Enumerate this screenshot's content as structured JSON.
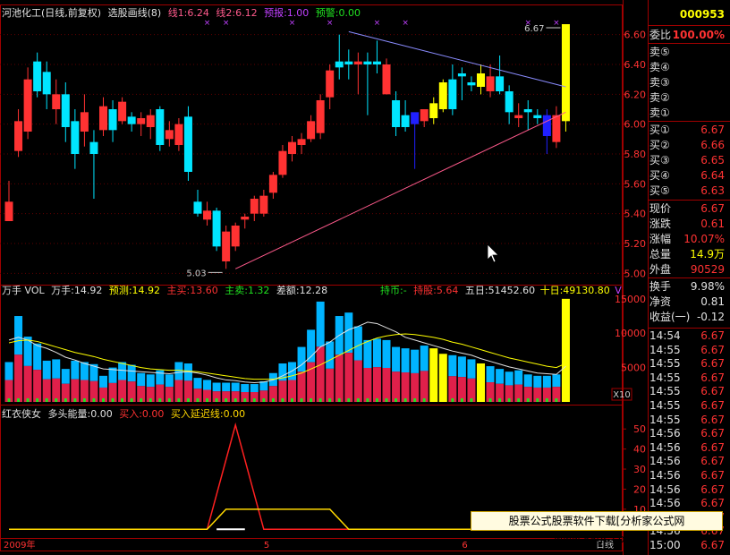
{
  "header": {
    "stock_name": "河池化工(日线,前复权)",
    "indicator_name": "选股画线(8)",
    "line1": "线1:6.24",
    "line2": "线2:6.12",
    "forecast": "预报:1.00",
    "alert": "预警:0.00"
  },
  "vol_header": {
    "title": "万手 VOL",
    "wanshou": "万手:14.92",
    "forecast": "预测:14.92",
    "buy_main": "主买:13.60",
    "sell_main": "主卖:1.32",
    "diff": "差额:12.28",
    "holding": "持币:-",
    "hold2": "持股:5.64",
    "ma5": "五日:51452.60",
    "ma10": "十日:49130.80",
    "v": "V"
  },
  "ind_header": {
    "name": "红衣侠女",
    "energy": "多头能量:0.00",
    "buy": "买入:0.00",
    "buy_delay": "买入延迟线:0.00"
  },
  "right_panel": {
    "code": "000953",
    "weibi_label": "委比",
    "weibi_value": "100.00%",
    "sell_labels": [
      "卖⑤",
      "卖④",
      "卖③",
      "卖②",
      "卖①"
    ],
    "buy_rows": [
      {
        "label": "买①",
        "value": "6.67"
      },
      {
        "label": "买②",
        "value": "6.66"
      },
      {
        "label": "买③",
        "value": "6.65"
      },
      {
        "label": "买④",
        "value": "6.64"
      },
      {
        "label": "买⑤",
        "value": "6.63"
      }
    ],
    "stats": [
      {
        "label": "现价",
        "value": "6.67",
        "color": "#ff3232"
      },
      {
        "label": "涨跌",
        "value": "0.61",
        "color": "#ff3232"
      },
      {
        "label": "涨幅",
        "value": "10.07%",
        "color": "#ff3232"
      },
      {
        "label": "总量",
        "value": "14.9万",
        "color": "#ffff00"
      },
      {
        "label": "外盘",
        "value": "90529",
        "color": "#ff3232"
      }
    ],
    "stats2": [
      {
        "label": "换手",
        "value": "9.98%",
        "color": "#e0e0e0"
      },
      {
        "label": "净资",
        "value": "0.81",
        "color": "#e0e0e0"
      },
      {
        "label": "收益(一)",
        "value": "-0.12",
        "color": "#e0e0e0"
      }
    ],
    "ticks": [
      {
        "time": "14:54",
        "price": "6.67"
      },
      {
        "time": "14:55",
        "price": "6.67"
      },
      {
        "time": "14:55",
        "price": "6.67"
      },
      {
        "time": "14:55",
        "price": "6.67"
      },
      {
        "time": "14:55",
        "price": "6.67"
      },
      {
        "time": "14:55",
        "price": "6.67"
      },
      {
        "time": "14:55",
        "price": "6.67"
      },
      {
        "time": "14:56",
        "price": "6.67"
      },
      {
        "time": "14:56",
        "price": "6.67"
      },
      {
        "time": "14:56",
        "price": "6.67"
      },
      {
        "time": "14:56",
        "price": "6.67"
      },
      {
        "time": "14:56",
        "price": "6.67"
      },
      {
        "time": "14:56",
        "price": "6.67"
      },
      {
        "time": "14:56",
        "price": "6.67"
      },
      {
        "time": "14:56",
        "price": "6.67"
      },
      {
        "time": "15:00",
        "price": "6.67"
      }
    ]
  },
  "watermark": "股票公式股票软件下载[分析家公式网www.88gs.com]",
  "bottom_labels": {
    "year": "2009年",
    "m5": "5",
    "m6": "6",
    "period": "日线"
  },
  "chart_data": [
    {
      "type": "candlestick",
      "title": "河池化工(日线,前复权)",
      "y_ticks": [
        5.0,
        5.2,
        5.4,
        5.6,
        5.8,
        6.0,
        6.2,
        6.4,
        6.6
      ],
      "ylim": [
        4.96,
        6.7
      ],
      "annotations": [
        {
          "label": "6.67"
        },
        {
          "label": "5.03"
        }
      ],
      "candles": [
        {
          "o": 5.48,
          "h": 5.62,
          "l": 5.38,
          "c": 5.35
        },
        {
          "o": 5.82,
          "h": 6.1,
          "l": 5.78,
          "c": 6.02
        },
        {
          "o": 5.95,
          "h": 6.38,
          "l": 5.9,
          "c": 6.3
        },
        {
          "o": 6.22,
          "h": 6.48,
          "l": 6.18,
          "c": 6.42
        },
        {
          "o": 6.2,
          "h": 6.42,
          "l": 6.1,
          "c": 6.35
        },
        {
          "o": 6.2,
          "h": 6.3,
          "l": 6.0,
          "c": 6.1
        },
        {
          "o": 6.2,
          "h": 6.28,
          "l": 5.88,
          "c": 5.98
        },
        {
          "o": 5.8,
          "h": 6.1,
          "l": 5.7,
          "c": 6.02
        },
        {
          "o": 6.08,
          "h": 6.2,
          "l": 5.85,
          "c": 5.95
        },
        {
          "o": 5.88,
          "h": 5.96,
          "l": 5.5,
          "c": 5.8
        },
        {
          "o": 5.96,
          "h": 6.18,
          "l": 5.92,
          "c": 6.12
        },
        {
          "o": 6.1,
          "h": 6.16,
          "l": 5.88,
          "c": 5.96
        },
        {
          "o": 6.15,
          "h": 6.18,
          "l": 6.0,
          "c": 6.02
        },
        {
          "o": 6.0,
          "h": 6.08,
          "l": 5.95,
          "c": 6.05
        },
        {
          "o": 6.04,
          "h": 6.08,
          "l": 5.92,
          "c": 6.0
        },
        {
          "o": 5.98,
          "h": 6.1,
          "l": 5.9,
          "c": 6.06
        },
        {
          "o": 6.1,
          "h": 6.12,
          "l": 5.82,
          "c": 5.86
        },
        {
          "o": 5.9,
          "h": 6.02,
          "l": 5.85,
          "c": 5.96
        },
        {
          "o": 5.86,
          "h": 6.04,
          "l": 5.82,
          "c": 6.0
        },
        {
          "o": 6.05,
          "h": 6.12,
          "l": 5.62,
          "c": 5.68
        },
        {
          "o": 5.48,
          "h": 5.56,
          "l": 5.38,
          "c": 5.4
        },
        {
          "o": 5.42,
          "h": 5.48,
          "l": 5.32,
          "c": 5.36
        },
        {
          "o": 5.42,
          "h": 5.44,
          "l": 5.15,
          "c": 5.18
        },
        {
          "o": 5.08,
          "h": 5.32,
          "l": 5.03,
          "c": 5.28
        },
        {
          "o": 5.18,
          "h": 5.34,
          "l": 5.15,
          "c": 5.32
        },
        {
          "o": 5.36,
          "h": 5.4,
          "l": 5.3,
          "c": 5.38
        },
        {
          "o": 5.4,
          "h": 5.52,
          "l": 5.35,
          "c": 5.5
        },
        {
          "o": 5.4,
          "h": 5.56,
          "l": 5.38,
          "c": 5.52
        },
        {
          "o": 5.54,
          "h": 5.68,
          "l": 5.5,
          "c": 5.66
        },
        {
          "o": 5.66,
          "h": 5.86,
          "l": 5.64,
          "c": 5.82
        },
        {
          "o": 5.8,
          "h": 5.92,
          "l": 5.75,
          "c": 5.88
        },
        {
          "o": 5.86,
          "h": 5.94,
          "l": 5.8,
          "c": 5.9
        },
        {
          "o": 5.9,
          "h": 6.06,
          "l": 5.88,
          "c": 6.02
        },
        {
          "o": 5.94,
          "h": 6.2,
          "l": 5.9,
          "c": 6.16
        },
        {
          "o": 6.18,
          "h": 6.4,
          "l": 6.1,
          "c": 6.36
        },
        {
          "o": 6.38,
          "h": 6.6,
          "l": 6.3,
          "c": 6.42
        },
        {
          "o": 6.42,
          "h": 6.5,
          "l": 6.3,
          "c": 6.4
        },
        {
          "o": 6.4,
          "h": 6.48,
          "l": 6.2,
          "c": 6.42
        },
        {
          "o": 6.42,
          "h": 6.48,
          "l": 6.06,
          "c": 6.4
        },
        {
          "o": 6.42,
          "h": 6.56,
          "l": 6.34,
          "c": 6.4
        },
        {
          "o": 6.4,
          "h": 6.44,
          "l": 6.2,
          "c": 6.2
        },
        {
          "o": 6.16,
          "h": 6.22,
          "l": 5.92,
          "c": 5.98
        },
        {
          "o": 5.98,
          "h": 6.16,
          "l": 5.95,
          "c": 6.06
        },
        {
          "o": 6.0,
          "h": 6.04,
          "l": 5.7,
          "c": 6.08
        },
        {
          "o": 6.02,
          "h": 6.1,
          "l": 5.98,
          "c": 6.1
        },
        {
          "o": 6.04,
          "h": 6.18,
          "l": 6.0,
          "c": 6.14
        },
        {
          "o": 6.1,
          "h": 6.3,
          "l": 6.08,
          "c": 6.28
        },
        {
          "o": 6.1,
          "h": 6.4,
          "l": 6.06,
          "c": 6.3
        },
        {
          "o": 6.32,
          "h": 6.38,
          "l": 6.16,
          "c": 6.34
        },
        {
          "o": 6.26,
          "h": 6.32,
          "l": 6.22,
          "c": 6.28
        },
        {
          "o": 6.34,
          "h": 6.4,
          "l": 6.2,
          "c": 6.25
        },
        {
          "o": 6.22,
          "h": 6.4,
          "l": 6.18,
          "c": 6.32
        },
        {
          "o": 6.22,
          "h": 6.46,
          "l": 6.2,
          "c": 6.32
        },
        {
          "o": 6.08,
          "h": 6.26,
          "l": 6.0,
          "c": 6.22
        },
        {
          "o": 6.04,
          "h": 6.14,
          "l": 5.98,
          "c": 6.06
        },
        {
          "o": 6.08,
          "h": 6.16,
          "l": 5.96,
          "c": 6.1
        },
        {
          "o": 6.04,
          "h": 6.1,
          "l": 6.0,
          "c": 6.06
        },
        {
          "o": 6.06,
          "h": 6.1,
          "l": 5.8,
          "c": 5.92
        },
        {
          "o": 6.06,
          "h": 6.12,
          "l": 5.84,
          "c": 5.88
        },
        {
          "o": 6.02,
          "h": 6.67,
          "l": 5.95,
          "c": 6.67
        }
      ],
      "body_colors": [
        "#ff3232",
        "#00e5ff",
        "#ffff00",
        "#2020ff"
      ],
      "candle_color_idx": [
        0,
        0,
        0,
        1,
        1,
        0,
        1,
        1,
        0,
        1,
        0,
        1,
        0,
        1,
        0,
        0,
        1,
        0,
        0,
        1,
        1,
        0,
        1,
        0,
        0,
        0,
        0,
        0,
        0,
        0,
        0,
        0,
        0,
        0,
        0,
        1,
        1,
        0,
        1,
        1,
        0,
        1,
        1,
        3,
        0,
        2,
        2,
        1,
        1,
        1,
        2,
        0,
        1,
        1,
        0,
        1,
        1,
        3,
        0,
        2
      ],
      "trendlines": [
        {
          "from": [
            24,
            5.03
          ],
          "to": [
            59,
            6.08
          ],
          "color": "#ff5a8c"
        },
        {
          "from": [
            36,
            6.62
          ],
          "to": [
            59,
            6.25
          ],
          "color": "#8a8cff"
        }
      ]
    },
    {
      "type": "bar",
      "title": "万手 VOL",
      "y_ticks": [
        5000,
        10000,
        15000
      ],
      "ylim": [
        0,
        15500
      ],
      "unit": "X10",
      "values": [
        5800,
        12500,
        9500,
        8500,
        6000,
        6200,
        4800,
        6000,
        5800,
        5500,
        3800,
        5000,
        5800,
        5400,
        4200,
        4000,
        4600,
        4000,
        5800,
        5600,
        3500,
        3200,
        2800,
        2800,
        2800,
        2600,
        2600,
        3000,
        4200,
        5600,
        5800,
        8000,
        10500,
        14600,
        8800,
        12500,
        13000,
        11000,
        9000,
        9200,
        9000,
        8000,
        7800,
        7600,
        8200,
        7800,
        7000,
        6800,
        6600,
        6200,
        5600,
        5200,
        4800,
        4400,
        4600,
        4000,
        3800,
        3800,
        4000,
        15000
      ],
      "ma5": [
        9000,
        9400,
        9000,
        8200,
        7800,
        7200,
        6500,
        6100,
        5600,
        5200,
        4800,
        4700,
        4600,
        4500,
        4400,
        4300,
        4200,
        4100,
        4300,
        4400,
        4200,
        3900,
        3500,
        3200,
        3100,
        2900,
        2800,
        2900,
        3200,
        3800,
        4500,
        5400,
        6600,
        8000,
        8700,
        9700,
        10500,
        11000,
        11600,
        11400,
        10800,
        10200,
        9400,
        9000,
        8600,
        8200,
        7800,
        7400,
        7100,
        6800,
        6300,
        5900,
        5500,
        5100,
        4800,
        4500,
        4200,
        4100,
        4000,
        5200
      ],
      "ma10": [
        8600,
        8900,
        9000,
        8800,
        8400,
        8000,
        7600,
        7200,
        6900,
        6600,
        6200,
        5900,
        5600,
        5300,
        5000,
        4800,
        4700,
        4600,
        4600,
        4500,
        4400,
        4200,
        4000,
        3800,
        3600,
        3400,
        3300,
        3300,
        3300,
        3500,
        3800,
        4200,
        4800,
        5400,
        6100,
        6800,
        7500,
        8200,
        8800,
        9300,
        9600,
        9800,
        9900,
        9800,
        9600,
        9400,
        9100,
        8700,
        8400,
        8000,
        7600,
        7200,
        6800,
        6400,
        6100,
        5800,
        5500,
        5200,
        5000,
        5600
      ]
    },
    {
      "type": "line",
      "title": "红衣侠女",
      "y_ticks": [
        0,
        10,
        20,
        30,
        40,
        50
      ],
      "ylim": [
        -3,
        55
      ],
      "series": [
        {
          "name": "多头能量",
          "points": [
            [
              0,
              0
            ],
            [
              21,
              0
            ],
            [
              24,
              52
            ],
            [
              27,
              0
            ],
            [
              59,
              0
            ]
          ],
          "color": "#ff2020"
        },
        {
          "name": "买入延迟线",
          "points": [
            [
              0,
              0
            ],
            [
              21,
              0
            ],
            [
              23,
              10
            ],
            [
              34,
              10
            ],
            [
              36,
              0
            ],
            [
              59,
              0
            ]
          ],
          "color": "#ffd800"
        }
      ]
    }
  ]
}
